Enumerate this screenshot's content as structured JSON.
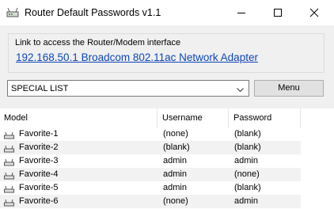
{
  "window": {
    "title": "Router Default Passwords v1.1",
    "icon": "router-app-icon",
    "controls": [
      "minimize-icon",
      "maximize-icon",
      "close-icon"
    ]
  },
  "link_group": {
    "label": "Link to access the Router/Modem interface",
    "link_text": "192.168.50.1   Broadcom 802.11ac Network Adapter",
    "link_color": "#0f46b8"
  },
  "filter": {
    "selected": "SPECIAL LIST",
    "menu_label": "Menu"
  },
  "table": {
    "columns": [
      "Model",
      "Username",
      "Password"
    ],
    "row_icon": "router-icon",
    "alt_row_color": "#f2f2f2",
    "rows": [
      {
        "model": "Favorite-1",
        "username": "(none)",
        "password": "(blank)"
      },
      {
        "model": "Favorite-2",
        "username": "(blank)",
        "password": "(blank)"
      },
      {
        "model": "Favorite-3",
        "username": "admin",
        "password": "admin"
      },
      {
        "model": "Favorite-4",
        "username": "admin",
        "password": "(none)"
      },
      {
        "model": "Favorite-5",
        "username": "admin",
        "password": "(blank)"
      },
      {
        "model": "Favorite-6",
        "username": "(none)",
        "password": "admin"
      }
    ]
  }
}
